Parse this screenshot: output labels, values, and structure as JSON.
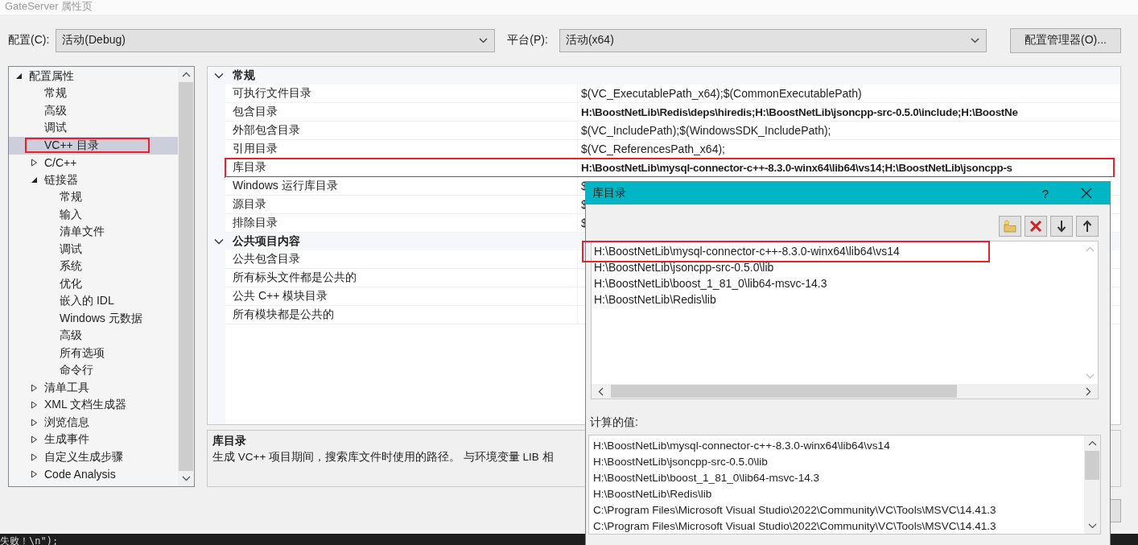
{
  "window": {
    "title": "GateServer 属性页"
  },
  "config_bar": {
    "configuration_label": "配置(C):",
    "configuration_value": "活动(Debug)",
    "platform_label": "平台(P):",
    "platform_value": "活动(x64)",
    "manager_button": "配置管理器(O)..."
  },
  "tree": {
    "items": [
      {
        "label": "配置属性",
        "selected": false,
        "highlighted": false,
        "expanded": true,
        "children": [
          {
            "label": "常规",
            "selected": false,
            "highlighted": false
          },
          {
            "label": "高级",
            "selected": false,
            "highlighted": false
          },
          {
            "label": "调试",
            "selected": false,
            "highlighted": false
          },
          {
            "label": "VC++ 目录",
            "selected": true,
            "highlighted": true
          },
          {
            "label": "C/C++",
            "selected": false,
            "highlighted": false,
            "expanded": false
          },
          {
            "label": "链接器",
            "selected": false,
            "highlighted": false,
            "expanded": true,
            "children": [
              {
                "label": "常规",
                "selected": false,
                "highlighted": false
              },
              {
                "label": "输入",
                "selected": false,
                "highlighted": false
              },
              {
                "label": "清单文件",
                "selected": false,
                "highlighted": false
              },
              {
                "label": "调试",
                "selected": false,
                "highlighted": false
              },
              {
                "label": "系统",
                "selected": false,
                "highlighted": false
              },
              {
                "label": "优化",
                "selected": false,
                "highlighted": false
              },
              {
                "label": "嵌入的 IDL",
                "selected": false,
                "highlighted": false
              },
              {
                "label": "Windows 元数据",
                "selected": false,
                "highlighted": false
              },
              {
                "label": "高级",
                "selected": false,
                "highlighted": false
              },
              {
                "label": "所有选项",
                "selected": false,
                "highlighted": false
              },
              {
                "label": "命令行",
                "selected": false,
                "highlighted": false
              }
            ]
          },
          {
            "label": "清单工具",
            "selected": false,
            "highlighted": false,
            "expanded": false
          },
          {
            "label": "XML 文档生成器",
            "selected": false,
            "highlighted": false,
            "expanded": false
          },
          {
            "label": "浏览信息",
            "selected": false,
            "highlighted": false,
            "expanded": false
          },
          {
            "label": "生成事件",
            "selected": false,
            "highlighted": false,
            "expanded": false
          },
          {
            "label": "自定义生成步骤",
            "selected": false,
            "highlighted": false,
            "expanded": false
          },
          {
            "label": "Code Analysis",
            "selected": false,
            "highlighted": false,
            "expanded": false
          }
        ]
      }
    ]
  },
  "property_grid": {
    "categories": [
      {
        "label": "常规",
        "expanded": true,
        "rows": [
          {
            "name": "可执行文件目录",
            "value": "$(VC_ExecutablePath_x64);$(CommonExecutablePath)",
            "bold": false,
            "highlighted": false
          },
          {
            "name": "包含目录",
            "value": "H:\\BoostNetLib\\Redis\\deps\\hiredis;H:\\BoostNetLib\\jsoncpp-src-0.5.0\\include;H:\\BoostNe",
            "bold": true,
            "highlighted": false
          },
          {
            "name": "外部包含目录",
            "value": "$(VC_IncludePath);$(WindowsSDK_IncludePath);",
            "bold": false,
            "highlighted": false
          },
          {
            "name": "引用目录",
            "value": "$(VC_ReferencesPath_x64);",
            "bold": false,
            "highlighted": false
          },
          {
            "name": "库目录",
            "value": "H:\\BoostNetLib\\mysql-connector-c++-8.3.0-winx64\\lib64\\vs14;H:\\BoostNetLib\\jsoncpp-s",
            "bold": true,
            "highlighted": true
          },
          {
            "name": "Windows 运行库目录",
            "value": "$",
            "bold": false,
            "highlighted": false
          },
          {
            "name": "源目录",
            "value": "$",
            "bold": false,
            "highlighted": false
          },
          {
            "name": "排除目录",
            "value": "$",
            "bold": false,
            "highlighted": false
          }
        ]
      },
      {
        "label": "公共项目内容",
        "expanded": true,
        "rows": [
          {
            "name": "公共包含目录",
            "highlighted": false
          },
          {
            "name": "所有标头文件都是公共的",
            "highlighted": false
          },
          {
            "name": "公共 C++ 模块目录",
            "highlighted": false
          },
          {
            "name": "所有模块都是公共的",
            "highlighted": false
          }
        ]
      }
    ]
  },
  "description": {
    "title": "库目录",
    "text": "生成 VC++ 项目期间，搜索库文件时使用的路径。 与环境变量 LIB 相"
  },
  "background_code": "失败！\\n\");",
  "dialog": {
    "title": "库目录",
    "help": "?",
    "entries": [
      {
        "text": "H:\\BoostNetLib\\mysql-connector-c++-8.3.0-winx64\\lib64\\vs14",
        "highlighted": true
      },
      {
        "text": "H:\\BoostNetLib\\jsoncpp-src-0.5.0\\lib",
        "highlighted": false
      },
      {
        "text": "H:\\BoostNetLib\\boost_1_81_0\\lib64-msvc-14.3",
        "highlighted": false
      },
      {
        "text": "H:\\BoostNetLib\\Redis\\lib",
        "highlighted": false
      }
    ],
    "computed_label": "计算的值:",
    "computed_values": [
      "H:\\BoostNetLib\\mysql-connector-c++-8.3.0-winx64\\lib64\\vs14",
      "H:\\BoostNetLib\\jsoncpp-src-0.5.0\\lib",
      "H:\\BoostNetLib\\boost_1_81_0\\lib64-msvc-14.3",
      "H:\\BoostNetLib\\Redis\\lib",
      "C:\\Program Files\\Microsoft Visual Studio\\2022\\Community\\VC\\Tools\\MSVC\\14.41.3",
      "C:\\Program Files\\Microsoft Visual Studio\\2022\\Community\\VC\\Tools\\MSVC\\14.41.3"
    ]
  }
}
